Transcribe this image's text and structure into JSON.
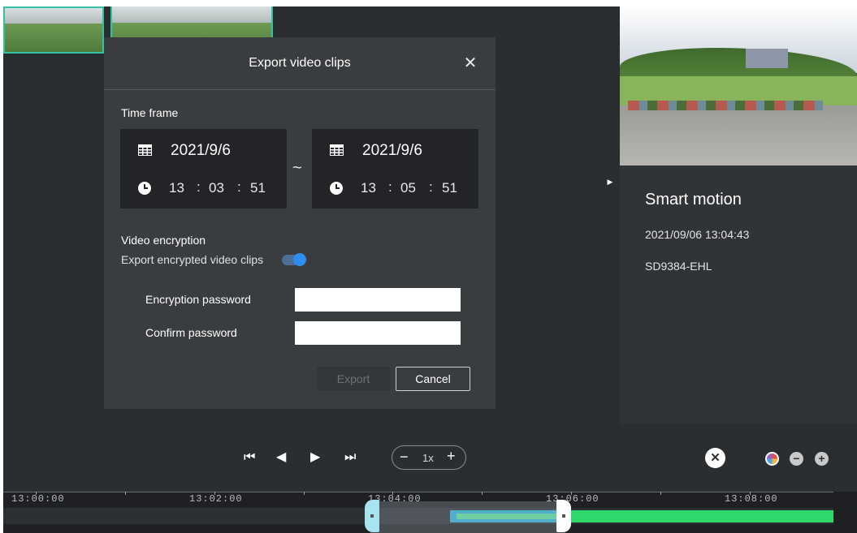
{
  "dialog": {
    "title": "Export video clips",
    "close_icon": "close-icon",
    "time_frame_label": "Time frame",
    "start": {
      "date": "2021/9/6",
      "hour": "13",
      "minute": "03",
      "second": "51"
    },
    "end": {
      "date": "2021/9/6",
      "hour": "13",
      "minute": "05",
      "second": "51"
    },
    "range_separator": "~",
    "time_separator": ":",
    "video_encryption_label": "Video encryption",
    "export_encrypted_label": "Export encrypted video clips",
    "encryption_enabled": true,
    "encryption_password_label": "Encryption password",
    "confirm_password_label": "Confirm password",
    "encryption_password_value": "",
    "confirm_password_value": "",
    "export_label": "Export",
    "cancel_label": "Cancel"
  },
  "event": {
    "title": "Smart motion",
    "timestamp": "2021/09/06 13:04:43",
    "camera": "SD9384-EHL"
  },
  "playback": {
    "speed": "1x",
    "minus": "−",
    "plus": "+",
    "controls": [
      "skip-start-icon",
      "step-back-icon",
      "play-icon",
      "skip-end-icon"
    ],
    "control_glyphs": [
      "⏮",
      "◀",
      "▶",
      "⏭"
    ],
    "clear_glyph": "✕",
    "zoom_out_glyph": "−",
    "zoom_in_glyph": "+"
  },
  "timeline": {
    "labels": [
      "13:00:00",
      "13:02:00",
      "13:04:00",
      "13:06:00",
      "13:08:00"
    ]
  },
  "colors": {
    "accent": "#2f8df0",
    "recording": "#2fd86a",
    "selection_border": "#35c0a2"
  }
}
